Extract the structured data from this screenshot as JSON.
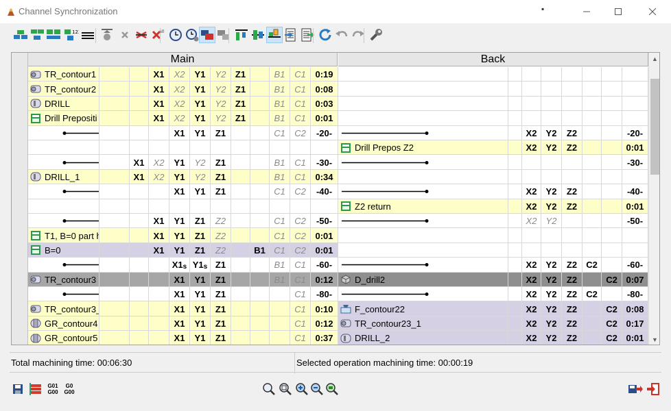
{
  "window": {
    "title": "Channel Synchronization",
    "extra_mark": "▪"
  },
  "toolbar": {
    "icons": [
      "add-top-icon",
      "add-bottom-icon",
      "add-both-icon",
      "number-icon",
      "lines-icon",
      "pin-icon",
      "delete-icon",
      "delete-sync-icon",
      "delete-all-icon",
      "clock-icon",
      "clock-gear-icon",
      "overlap-icon",
      "overlap2-icon",
      "align-top-icon",
      "align-mid-icon",
      "align-hand-icon",
      "doc-left-icon",
      "doc-right-icon",
      "refresh-icon",
      "undo-icon",
      "redo-icon",
      "wrench-icon"
    ]
  },
  "headers": {
    "main": "Main",
    "back": "Back"
  },
  "colors": {
    "yellow": "#fefec8",
    "purple": "#d6d0e4",
    "gray": "#a6a6a6",
    "darkgray": "#8f8f8f",
    "white": "#ffffff"
  },
  "rows": [
    {
      "bg": "yellow",
      "mname": "TR_contour1",
      "micon": "turn",
      "m": [
        "",
        "",
        "X1",
        "X2",
        "Y1",
        "Y2",
        "Z1",
        "",
        "B1",
        "C1",
        "0:19"
      ],
      "bname": "",
      "bicon": "",
      "b": [
        "",
        "",
        "",
        "",
        "",
        "",
        ""
      ]
    },
    {
      "bg": "yellow",
      "mname": "TR_contour2",
      "micon": "turn",
      "m": [
        "",
        "",
        "X1",
        "X2",
        "Y1",
        "Y2",
        "Z1",
        "",
        "B1",
        "C1",
        "0:08"
      ],
      "bname": "",
      "bicon": "",
      "b": [
        "",
        "",
        "",
        "",
        "",
        "",
        ""
      ]
    },
    {
      "bg": "yellow",
      "mname": "DRILL",
      "micon": "drill",
      "m": [
        "",
        "",
        "X1",
        "X2",
        "Y1",
        "Y2",
        "Z1",
        "",
        "B1",
        "C1",
        "0:03"
      ],
      "bname": "",
      "bicon": "",
      "b": [
        "",
        "",
        "",
        "",
        "",
        "",
        ""
      ]
    },
    {
      "bg": "yellow",
      "mname": "Drill Prepositi",
      "micon": "green",
      "m": [
        "",
        "",
        "X1",
        "X2",
        "Y1",
        "Y2",
        "Z1",
        "",
        "B1",
        "C1",
        "0:01"
      ],
      "bname": "",
      "bicon": "",
      "b": [
        "",
        "",
        "",
        "",
        "",
        "",
        ""
      ]
    },
    {
      "bg": "white",
      "mline": true,
      "m": [
        "",
        "",
        "",
        "X1",
        "Y1",
        "Z1",
        "",
        "",
        "C1",
        "C2",
        "-20-"
      ],
      "bline": true,
      "b": [
        "",
        "X2",
        "Y2",
        "Z2",
        "",
        "",
        "-20-"
      ]
    },
    {
      "bg": "white",
      "mname": "",
      "m": [
        "",
        "",
        "",
        "",
        "",
        "",
        "",
        "",
        "",
        "",
        ""
      ],
      "bbg": "yellow",
      "bname": "Drill Prepos Z2",
      "bicon": "green",
      "b": [
        "",
        "X2",
        "Y2",
        "Z2",
        "",
        "",
        "0:01"
      ]
    },
    {
      "bg": "white",
      "mline": true,
      "m": [
        "",
        "X1",
        "X2",
        "Y1",
        "Y2",
        "Z1",
        "",
        "",
        "B1",
        "C1",
        "-30-"
      ],
      "bline": true,
      "b": [
        "",
        "",
        "",
        "",
        "",
        "",
        "-30-"
      ]
    },
    {
      "bg": "yellow",
      "mname": "DRILL_1",
      "micon": "drill",
      "m": [
        "",
        "X1",
        "X2",
        "Y1",
        "Y2",
        "Z1",
        "",
        "",
        "B1",
        "C1",
        "0:34"
      ],
      "bname": "",
      "b": [
        "",
        "",
        "",
        "",
        "",
        "",
        ""
      ]
    },
    {
      "bg": "white",
      "mline": true,
      "m": [
        "",
        "",
        "",
        "X1",
        "Y1",
        "Z1",
        "",
        "",
        "C1",
        "C2",
        "-40-"
      ],
      "bline": true,
      "b": [
        "",
        "X2",
        "Y2",
        "Z2",
        "",
        "",
        "-40-"
      ]
    },
    {
      "bg": "white",
      "mname": "",
      "m": [
        "",
        "",
        "",
        "",
        "",
        "",
        "",
        "",
        "",
        "",
        ""
      ],
      "bbg": "yellow",
      "bname": "Z2 return",
      "bicon": "green",
      "b": [
        "",
        "X2",
        "Y2",
        "Z2",
        "",
        "",
        "0:01"
      ]
    },
    {
      "bg": "white",
      "mline": true,
      "m": [
        "",
        "",
        "X1",
        "Y1",
        "Z1",
        "Z2",
        "",
        "",
        "C1",
        "C2",
        "-50-"
      ],
      "bline": true,
      "b": [
        "",
        "X2",
        "Y2",
        "",
        "",
        "",
        "-50-"
      ]
    },
    {
      "bg": "yellow",
      "mname": "T1, B=0 part h",
      "micon": "green",
      "m": [
        "",
        "",
        "X1",
        "Y1",
        "Z1",
        "Z2",
        "",
        "",
        "C1",
        "C2",
        "0:01"
      ],
      "bname": "",
      "b": [
        "",
        "",
        "",
        "",
        "",
        "",
        ""
      ]
    },
    {
      "bg": "purple",
      "mname": "B=0",
      "micon": "green",
      "m": [
        "",
        "",
        "X1",
        "Y1",
        "Z1",
        "Z2",
        "",
        "B1",
        "C1",
        "C2",
        "0:01"
      ],
      "bname": "",
      "b": [
        "",
        "",
        "",
        "",
        "",
        "",
        ""
      ]
    },
    {
      "bg": "white",
      "mline": true,
      "m": [
        "",
        "",
        "",
        "X1s",
        "Y1s",
        "Z1",
        "",
        "",
        "B1",
        "C1",
        "-60-"
      ],
      "bline": true,
      "b": [
        "",
        "X2",
        "Y2",
        "Z2",
        "C2",
        "",
        "-60-"
      ]
    },
    {
      "bg": "gray",
      "mname": "TR_contour3",
      "micon": "turn",
      "m": [
        "",
        "",
        "",
        "X1",
        "Y1",
        "Z1",
        "",
        "",
        "B1",
        "C1",
        "0:12"
      ],
      "bbg": "darkgray",
      "bname": "D_drill2",
      "bicon": "box",
      "b": [
        "",
        "X2",
        "Y2",
        "Z2",
        "",
        "C2",
        "0:07"
      ]
    },
    {
      "bg": "white",
      "mline": true,
      "m": [
        "",
        "",
        "",
        "X1",
        "Y1",
        "Z1",
        "",
        "",
        "",
        "C1",
        "-80-"
      ],
      "bline": true,
      "b": [
        "",
        "X2",
        "Y2",
        "Z2",
        "C2",
        "",
        "-80-"
      ]
    },
    {
      "bg": "yellow",
      "mname": "TR_contour3_",
      "micon": "turn",
      "m": [
        "",
        "",
        "",
        "X1",
        "Y1",
        "Z1",
        "",
        "",
        "",
        "C1",
        "0:10"
      ],
      "bbg": "purple",
      "bname": "F_contour22",
      "bicon": "mill",
      "b": [
        "",
        "X2",
        "Y2",
        "Z2",
        "",
        "C2",
        "0:08"
      ]
    },
    {
      "bg": "yellow",
      "mname": "GR_contour4",
      "micon": "grind",
      "m": [
        "",
        "",
        "",
        "X1",
        "Y1",
        "Z1",
        "",
        "",
        "",
        "C1",
        "0:12"
      ],
      "bbg": "purple",
      "bname": "TR_contour23_1",
      "bicon": "turn",
      "b": [
        "",
        "X2",
        "Y2",
        "Z2",
        "",
        "C2",
        "0:17"
      ]
    },
    {
      "bg": "yellow",
      "mname": "GR_contour5",
      "micon": "grind",
      "m": [
        "",
        "",
        "",
        "X1",
        "Y1",
        "Z1",
        "",
        "",
        "",
        "C1",
        "0:37"
      ],
      "bbg": "purple",
      "bname": "DRILL_2",
      "bicon": "drill",
      "b": [
        "",
        "X2",
        "Y2",
        "Z2",
        "",
        "C2",
        "0:01"
      ]
    }
  ],
  "status": {
    "total": "Total machining time: 00:06:30",
    "selected": "Selected operation machining time: 00:00:19"
  },
  "bottom": {
    "gcode_a_top": "G01",
    "gcode_a_bot": "G00",
    "gcode_b_top": "G0",
    "gcode_b_bot": "G00"
  }
}
